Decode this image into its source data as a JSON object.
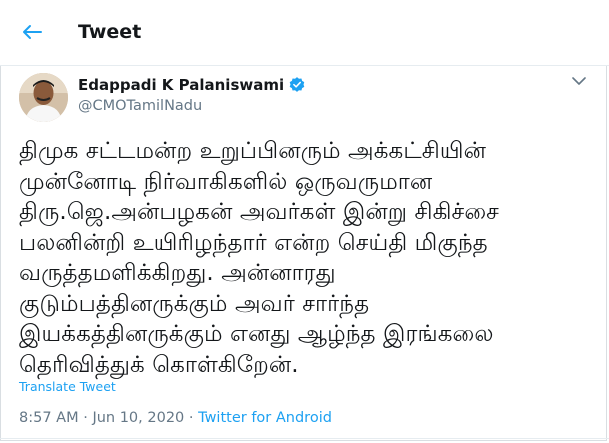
{
  "header": {
    "title": "Tweet"
  },
  "author": {
    "name": "Edappadi K Palaniswami",
    "handle": "@CMOTamilNadu"
  },
  "tweet": {
    "text": "திமுக சட்டமன்ற உறுப்பினரும் அக்கட்சியின்\nமுன்னோடி நிர்வாகிகளில் ஒருவருமான\nதிரு.ஜெ.அன்பழகன் அவர்கள் இன்று சிகிச்சை\nபலனின்றி உயிரிழந்தார் என்ற செய்தி மிகுந்த\nவருத்தமளிக்கிறது. அன்னாரது\nகுடும்பத்தினருக்கும் அவர் சார்ந்த\nஇயக்கத்தினருக்கும் எனது ஆழ்ந்த இரங்கலை\nதெரிவித்துக் கொள்கிறேன்.",
    "translate_label": "Translate Tweet"
  },
  "meta": {
    "time": "8:57 AM",
    "separator": " · ",
    "date": "Jun 10, 2020",
    "source": "Twitter for Android"
  },
  "colors": {
    "accent": "#1da1f2",
    "secondary_text": "#657786",
    "primary_text": "#14171a"
  },
  "icons": {
    "back": "arrow-left-icon",
    "verified": "verified-badge-icon",
    "menu": "chevron-down-icon"
  }
}
